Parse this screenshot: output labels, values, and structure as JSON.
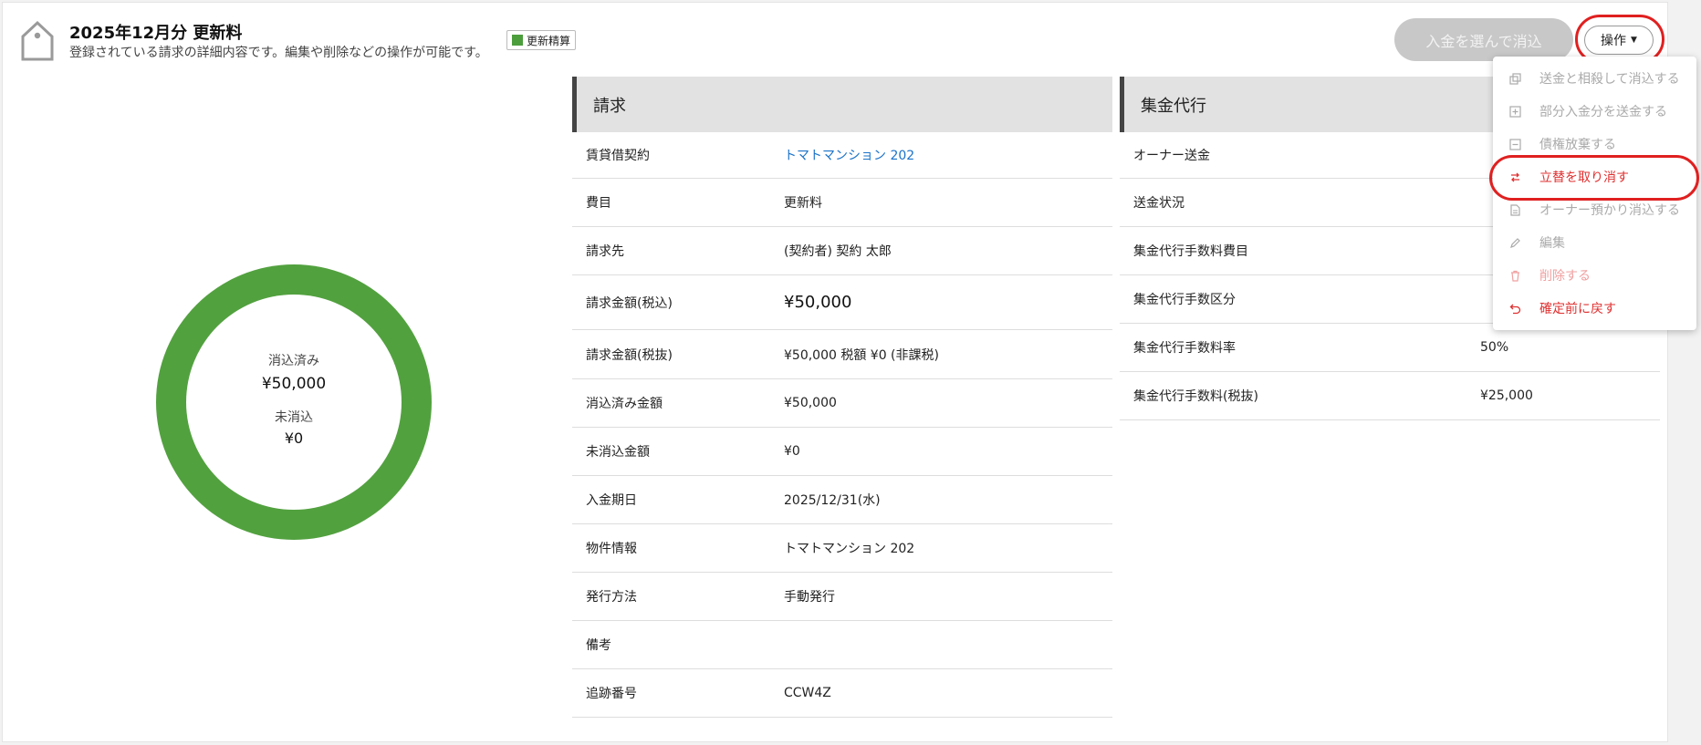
{
  "header": {
    "title": "2025年12月分 更新料",
    "description": "登録されている請求の詳細内容です。編集や削除などの操作が可能です。",
    "badge": "更新精算",
    "reconcile_button": "入金を選んで消込",
    "ops_button": "操作"
  },
  "colors": {
    "accent_green": "#52a13f",
    "link_blue": "#1a73c9",
    "danger_red": "#e03030",
    "highlight_ring": "#e02020"
  },
  "summary": {
    "cleared_label": "消込済み",
    "cleared_value": "¥50,000",
    "uncleared_label": "未消込",
    "uncleared_value": "¥0",
    "cleared_fraction": 1.0
  },
  "billing": {
    "title": "請求",
    "rows": [
      {
        "label": "賃貸借契約",
        "value": "トマトマンション 202"
      },
      {
        "label": "費目",
        "value": "更新料"
      },
      {
        "label": "請求先",
        "value": "(契約者) 契約 太郎"
      },
      {
        "label": "請求金額(税込)",
        "value": "¥50,000"
      },
      {
        "label": "請求金額(税抜)",
        "value": "¥50,000  税額 ¥0 (非課税)"
      },
      {
        "label": "消込済み金額",
        "value": "¥50,000"
      },
      {
        "label": "未消込金額",
        "value": "¥0"
      },
      {
        "label": "入金期日",
        "value": "2025/12/31(水)"
      },
      {
        "label": "物件情報",
        "value": "トマトマンション 202"
      },
      {
        "label": "発行方法",
        "value": "手動発行"
      },
      {
        "label": "備考",
        "value": ""
      },
      {
        "label": "追跡番号",
        "value": "CCW4Z"
      }
    ]
  },
  "collection": {
    "title": "集金代行",
    "rows": [
      {
        "label": "オーナー送金",
        "value": ""
      },
      {
        "label": "送金状況",
        "value": ""
      },
      {
        "label": "集金代行手数料費目",
        "value": ""
      },
      {
        "label": "集金代行手数区分",
        "value": ""
      },
      {
        "label": "集金代行手数料率",
        "value": "50%"
      },
      {
        "label": "集金代行手数料(税抜)",
        "value": "¥25,000"
      }
    ]
  },
  "menu": {
    "items": [
      {
        "label": "送金と相殺して消込する",
        "icon": "copy-icon"
      },
      {
        "label": "部分入金分を送金する",
        "icon": "plus-square-icon"
      },
      {
        "label": "債権放棄する",
        "icon": "minus-square-icon"
      },
      {
        "label": "立替を取り消す",
        "icon": "swap-icon"
      },
      {
        "label": "オーナー預かり消込する",
        "icon": "document-icon"
      },
      {
        "label": "編集",
        "icon": "pencil-icon"
      },
      {
        "label": "削除する",
        "icon": "trash-icon"
      },
      {
        "label": "確定前に戻す",
        "icon": "undo-icon"
      }
    ]
  }
}
